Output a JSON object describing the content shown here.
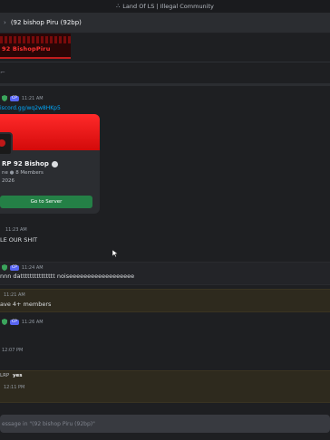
{
  "window": {
    "title": "Land Of LS | Illegal Community"
  },
  "channel": {
    "name": "(92 bishop Piru (92bp)"
  },
  "banner": {
    "text": "92 BishopPiru"
  },
  "messages": [
    {
      "time": "11:21 AM",
      "tag": "CP",
      "link": "iscord.gg/wq2w8HKp5"
    },
    {
      "time": "11:23 AM",
      "text": "LE OUR SHIT"
    },
    {
      "time": "11:24 AM",
      "tag": "CP",
      "text": "nnn dattttttttttttttt noiseeeeeeeeeeeeeeeeee"
    },
    {
      "time": "11:21 AM",
      "text": "ave 4+ members"
    },
    {
      "time": "11:26 AM",
      "tag": "CP"
    },
    {
      "time": "12:07 PM"
    },
    {
      "author_fragment": "LRP",
      "text": "yes",
      "time": "12:11 PM"
    }
  ],
  "invite": {
    "server_name": "RP 92 Bishop",
    "status_fragment": "ne",
    "members": "8 Members",
    "established": "2026",
    "button_label": "Go to Server"
  },
  "composer": {
    "placeholder": "essage in \"(92 bishop Piru (92bp)\""
  },
  "colors": {
    "accent": "#5865f2",
    "join": "#248046",
    "banner_red": "#e01616",
    "link": "#00a8fc"
  }
}
